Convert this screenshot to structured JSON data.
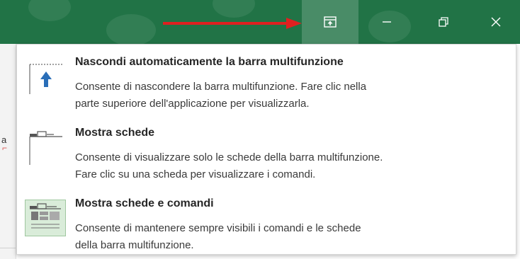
{
  "options": [
    {
      "title": "Nascondi automaticamente la barra multifunzione",
      "desc_line1": "Consente di nascondere la barra multifunzione. Fare clic nella",
      "desc_line2": "parte superiore dell'applicazione per visualizzarla."
    },
    {
      "title": "Mostra schede",
      "desc_line1": "Consente di visualizzare solo le schede della barra multifunzione.",
      "desc_line2": "Fare clic su una scheda per visualizzare i comandi."
    },
    {
      "title": "Mostra schede e comandi",
      "desc_line1": "Consente di mantenere sempre visibili i comandi e le schede",
      "desc_line2": "della barra multifunzione."
    }
  ],
  "left_fragment": "a",
  "colors": {
    "titlebar": "#217346",
    "arrow": "#e02020",
    "icon_blue": "#2a6eb8",
    "selected": "#d9ecd9"
  },
  "window_controls": [
    "ribbon-display-options-icon",
    "minimize-icon",
    "restore-icon",
    "close-icon"
  ]
}
